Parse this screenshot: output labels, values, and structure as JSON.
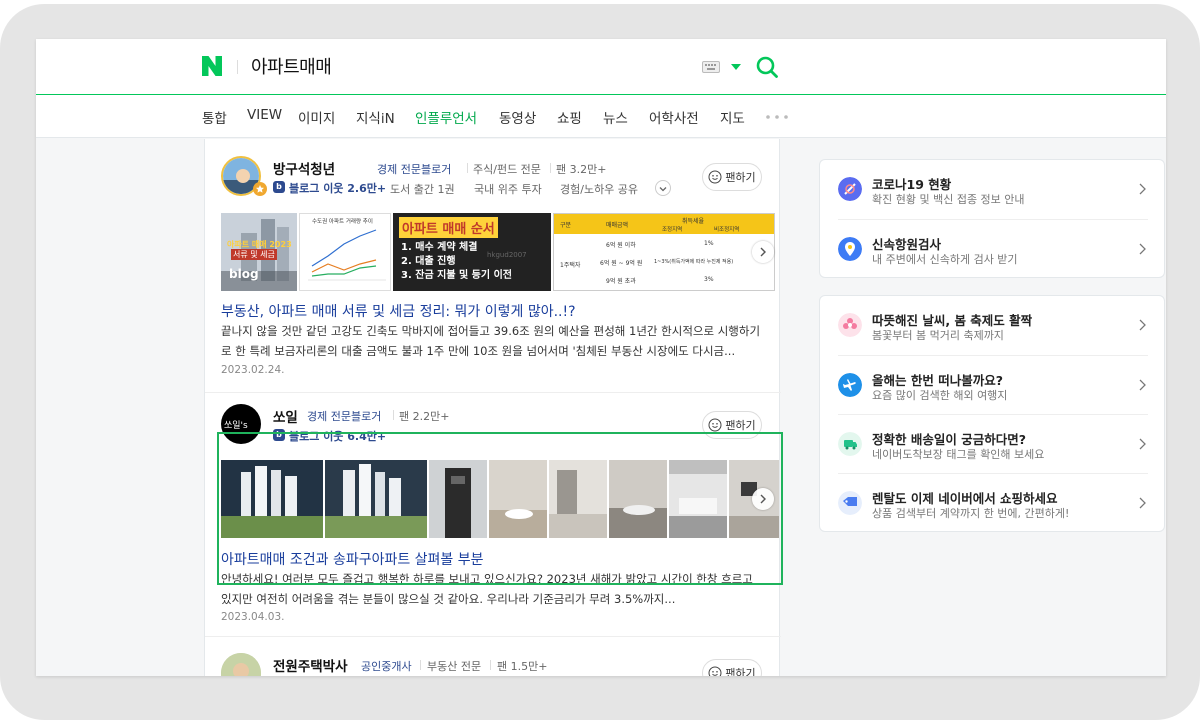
{
  "header": {
    "query": "아파트매매"
  },
  "nav": {
    "items": [
      "통합",
      "VIEW",
      "이미지",
      "지식iN",
      "인플루언서",
      "동영상",
      "쇼핑",
      "뉴스",
      "어학사전",
      "지도"
    ],
    "active": "인플루언서"
  },
  "posts": [
    {
      "author": "방구석청년",
      "category": "경제 전문블로거",
      "topic": "주식/펀드 전문",
      "fans": "팬 3.2만+",
      "neighbors": "블로그 이웃 2.6만+",
      "book": "도서 출간 1권",
      "residence": "국내 위주 투자",
      "career": "경험/노하우 공유",
      "fan_button": "팬하기",
      "thumbs": {
        "t1_tag": "아파트 매매 2023",
        "t1_sub": "서류 및 세금",
        "t1_blog": "blog",
        "t2_head": "수도권 아파트 거래량 추이",
        "t3_title": "아파트 매매 순서",
        "t3_steps": [
          "1. 매수 계약 체결",
          "2. 대출 진행",
          "3. 잔금 지불 및 등기 이전"
        ],
        "t3_watermark": "hkgud2007",
        "t4_headers": [
          "구분",
          "매매금액",
          "취득세율",
          "조정지역",
          "비조정지역"
        ],
        "t4_row_label": "1주택자",
        "t4_rows": [
          [
            "6억 원 이하",
            "1%"
          ],
          [
            "6억 원 ~ 9억 원",
            "1~3%(취득가액에 따라 누진제 적용)"
          ],
          [
            "9억 원 초과",
            "3%"
          ]
        ]
      },
      "title_pre": "부동산, ",
      "title_hl": "아파트 매매",
      "title_post": " 서류 및 세금 정리: 뭐가 이렇게 많아..!?",
      "desc": "끝나지 않을 것만 같던 고강도 긴축도 막바지에 접어들고 39.6조 원의 예산을 편성해 1년간 한시적으로 시행하기로 한 특례 보금자리론의 대출 금액도 불과 1주 만에 10조 원을 넘어서며 '침체된 부동산 시장에도 다시금...",
      "date": "2023.02.24."
    },
    {
      "author": "쏘일",
      "avatar_text": "쏘일's",
      "category": "경제 전문블로거",
      "fans": "팬 2.2만+",
      "neighbors": "블로그 이웃 6.4만+",
      "fan_button": "팬하기",
      "title_hl": "아파트매매",
      "title_post": " 조건과 송파구아파트 살펴볼 부분",
      "desc": "안녕하세요! 여러분 모두 즐겁고 행복한 하루를 보내고 있으신가요? 2023년 새해가 밝았고 시간이 한창 흐르고 있지만 여전히 어려움을 겪는 분들이 많으실 것 같아요. 우리나라 기준금리가 무려 3.5%까지...",
      "date": "2023.04.03."
    },
    {
      "author": "전원주택박사",
      "category": "공인중개사",
      "topic": "부동산 전문",
      "fans": "팬 1.5만+",
      "fan_button": "팬하기"
    }
  ],
  "side_panels": [
    {
      "items": [
        {
          "title": "코로나19 현황",
          "subtitle": "확진 현황 및 백신 접종 정보 안내",
          "icon": "covid-icon",
          "color": "#5a6cf0"
        },
        {
          "title": "신속항원검사",
          "subtitle": "내 주변에서 신속하게 검사 받기",
          "icon": "location-icon",
          "color": "#3d7bf5"
        }
      ]
    },
    {
      "items": [
        {
          "title": "따뜻해진 날씨, 봄 축제도 활짝",
          "subtitle": "봄꽃부터 봄 먹거리 축제까지",
          "icon": "flower-icon",
          "color": "#f47ba0"
        },
        {
          "title": "올해는 한번 떠나볼까요?",
          "subtitle": "요즘 많이 검색한 해외 여행지",
          "icon": "airplane-icon",
          "color": "#1e90e8"
        },
        {
          "title": "정확한 배송일이 궁금하다면?",
          "subtitle": "네이버도착보장 태그를 확인해 보세요",
          "icon": "delivery-icon",
          "color": "#22c28a"
        },
        {
          "title": "렌탈도 이제 네이버에서 쇼핑하세요",
          "subtitle": "상품 검색부터 계약까지 한 번에, 간편하게!",
          "icon": "rental-tag-icon",
          "color": "#4a7cf0"
        }
      ]
    }
  ],
  "colors": {
    "naver_green": "#03c75a",
    "link_blue": "#1a3e9c",
    "highlight_border": "#1fb35c"
  }
}
